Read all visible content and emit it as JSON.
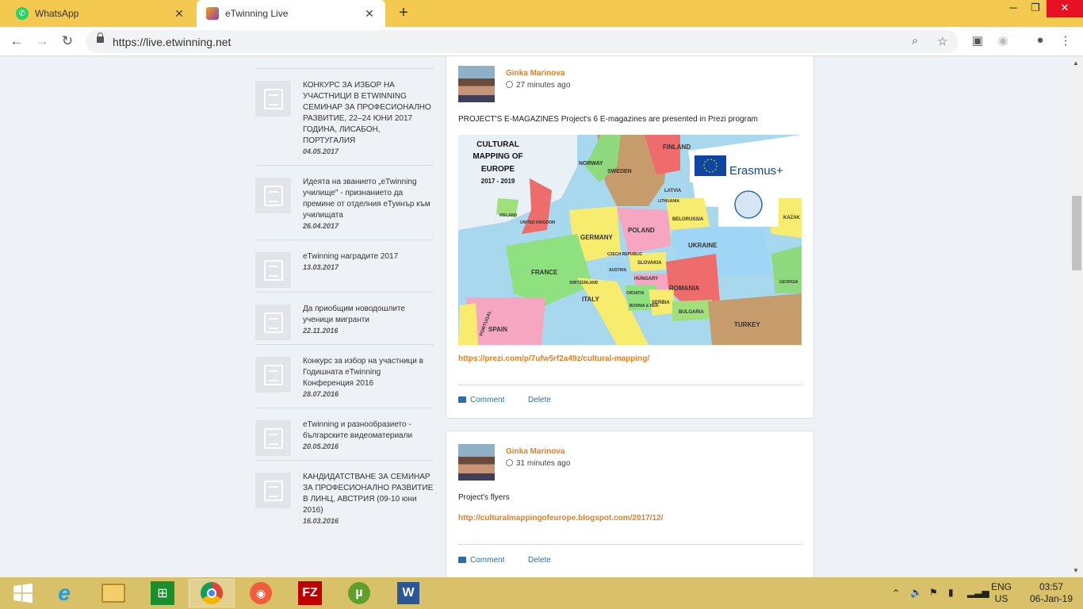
{
  "browser": {
    "tabs": [
      {
        "title": "WhatsApp",
        "active": false
      },
      {
        "title": "eTwinning Live",
        "active": true
      }
    ],
    "url": "https://live.etwinning.net"
  },
  "news": [
    {
      "title": "КОНКУРС ЗА ИЗБОР НА УЧАСТНИЦИ В ETWINNING СЕМИНАР ЗА ПРОФЕСИОНАЛНО РАЗВИТИЕ, 22–24 ЮНИ 2017 ГОДИНА, ЛИСАБОН, ПОРТУГАЛИЯ",
      "date": "04.05.2017"
    },
    {
      "title": "Идеята на званието „eTwinning училище\" - признанието да премине от отделния еТуинър към училищата",
      "date": "26.04.2017"
    },
    {
      "title": "eTwinning наградите 2017",
      "date": "13.03.2017"
    },
    {
      "title": "Да приобщим новодошлите ученици мигранти",
      "date": "22.11.2016"
    },
    {
      "title": "Конкурс за избор на участници в Годишната eTwinning Конференция 2016",
      "date": "28.07.2016"
    },
    {
      "title": "eTwinning и разнообразието - българските видеоматериали",
      "date": "20.05.2016"
    },
    {
      "title": "КАНДИДАТСТВАНЕ ЗА СЕМИНАР ЗА ПРОФЕСИОНАЛНО РАЗВИТИЕ В ЛИНЦ, АВСТРИЯ (09-10 юни 2016)",
      "date": "16.03.2016"
    }
  ],
  "posts": [
    {
      "author": "Ginka Marinova",
      "time": "27 minutes ago",
      "text": "PROJECT'S E-MAGAZINES Project's 6 E-magazines are presented in Prezi program",
      "link": "https://prezi.com/p/7ufw5rf2a49z/cultural-mapping/",
      "comment_label": "Comment",
      "delete_label": "Delete",
      "image": {
        "title_lines": [
          "CULTURAL",
          "MAPPING OF",
          "EUROPE"
        ],
        "years": "2017 - 2019",
        "badge": "Erasmus+",
        "countries": [
          "FINLAND",
          "NORWAY",
          "SWEDEN",
          "LATVIA",
          "LITHUANIA",
          "BELORUSSIA",
          "UNITED KINGDOM",
          "POLAND",
          "GERMANY",
          "UKRAINE",
          "CZECH REPUBLIC",
          "SLOVAKIA",
          "AUSTRIA",
          "HUNGARY",
          "FRANCE",
          "SWITZERLAND",
          "ROMANIA",
          "ITALY",
          "CROATIA",
          "BOSNIA & HER.",
          "SERBIA",
          "BULGARIA",
          "SPAIN",
          "PORTUGAL",
          "TURKEY",
          "GEORGIA",
          "KAZAK",
          "IRELAND"
        ]
      }
    },
    {
      "author": "Ginka Marinova",
      "time": "31 minutes ago",
      "text": "Project's flyers",
      "link": "http://culturalmappingofeurope.blogspot.com/2017/12/",
      "comment_label": "Comment",
      "delete_label": "Delete"
    }
  ],
  "tray": {
    "lang": "ENG",
    "region": "US",
    "time": "03:57",
    "date": "06-Jan-19"
  },
  "colors": {
    "tabstrip": "#f4c94f",
    "taskbar": "#d9c169",
    "accent_orange": "#e67e22",
    "link_blue": "#2a6fa8"
  },
  "icons": [
    "back-icon",
    "forward-icon",
    "reload-icon",
    "lock-icon",
    "zoom-icon",
    "star-icon",
    "cast-icon",
    "extension-icon",
    "profile-icon",
    "menu-icon",
    "clock-icon",
    "comment-icon"
  ]
}
